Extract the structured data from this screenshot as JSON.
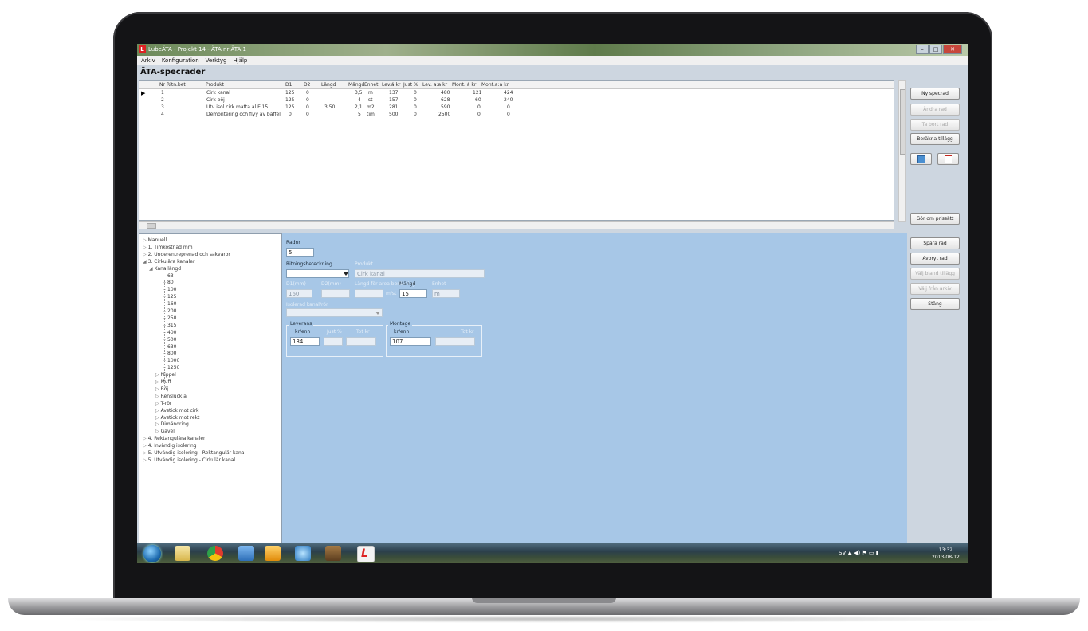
{
  "window": {
    "title": "LubeÄTA - Projekt 14 - ÄTA nr ÄTA 1",
    "menu": [
      "Arkiv",
      "Konfiguration",
      "Verktyg",
      "Hjälp"
    ]
  },
  "page_title": "ÄTA-specrader",
  "grid": {
    "columns": [
      "Nr",
      "Ritn.bet",
      "Produkt",
      "D1",
      "D2",
      "Längd",
      "Mängd",
      "Enhet",
      "Lev.á kr",
      "Just %",
      "Lev. a:a kr",
      "Mont. á kr",
      "Mont.a:a kr"
    ],
    "rows": [
      [
        "1",
        "",
        "Cirk kanal",
        "125",
        "0",
        "",
        "3,5",
        "m",
        "137",
        "0",
        "480",
        "121",
        "424"
      ],
      [
        "2",
        "",
        "Cirk böj",
        "125",
        "0",
        "",
        "4",
        "st",
        "157",
        "0",
        "628",
        "60",
        "240"
      ],
      [
        "3",
        "",
        "Utv isol cirk matta al El15",
        "125",
        "0",
        "3,50",
        "2,1",
        "m2",
        "281",
        "0",
        "590",
        "0",
        "0"
      ],
      [
        "4",
        "",
        "Demontering och flyy av baffel",
        "0",
        "0",
        "",
        "5",
        "tim",
        "500",
        "0",
        "2500",
        "0",
        "0"
      ]
    ]
  },
  "right_buttons": {
    "ny_specrad": "Ny specrad",
    "andra_rad": "Ändra rad",
    "ta_bort_rad": "Ta bort rad",
    "berakna_tillagg": "Beräkna tillägg",
    "gor_om_prissatt": "Gör om prissätt",
    "spara_rad": "Spara rad",
    "avbryt_rad": "Avbryt rad",
    "valj_bland_tillagg": "Välj bland tillägg",
    "valj_fran_arkiv": "Välj från arkiv",
    "stang": "Stäng"
  },
  "tree": {
    "items": [
      {
        "label": "Manuell",
        "level": 0
      },
      {
        "label": "1. Timkostnad mm",
        "level": 0
      },
      {
        "label": "2. Underentreprenad och sakvaror",
        "level": 0
      },
      {
        "label": "3. Cirkulära kanaler",
        "level": 0
      },
      {
        "label": "Kanallängd",
        "level": 1
      },
      {
        "label": "63",
        "level": 3
      },
      {
        "label": "80",
        "level": 3
      },
      {
        "label": "100",
        "level": 3
      },
      {
        "label": "125",
        "level": 3
      },
      {
        "label": "160",
        "level": 3
      },
      {
        "label": "200",
        "level": 3
      },
      {
        "label": "250",
        "level": 3
      },
      {
        "label": "315",
        "level": 3
      },
      {
        "label": "400",
        "level": 3
      },
      {
        "label": "500",
        "level": 3
      },
      {
        "label": "630",
        "level": 3
      },
      {
        "label": "800",
        "level": 3
      },
      {
        "label": "1000",
        "level": 3
      },
      {
        "label": "1250",
        "level": 3
      },
      {
        "label": "Nippel",
        "level": 2
      },
      {
        "label": "Muff",
        "level": 2
      },
      {
        "label": "Böj",
        "level": 2
      },
      {
        "label": "Rensluck a",
        "level": 2
      },
      {
        "label": "T-rör",
        "level": 2
      },
      {
        "label": "Avstick mot cirk",
        "level": 2
      },
      {
        "label": "Avstick mot rekt",
        "level": 2
      },
      {
        "label": "Dimändring",
        "level": 2
      },
      {
        "label": "Gavel",
        "level": 2
      },
      {
        "label": "4. Rektangulära kanaler",
        "level": 0
      },
      {
        "label": "4. Invändig isolering",
        "level": 0
      },
      {
        "label": "5. Utvändig isolering - Rektangulär kanal",
        "level": 0
      },
      {
        "label": "5. Utvändig isolering - Cirkulär kanal",
        "level": 0
      }
    ]
  },
  "editor": {
    "radnr_label": "Radnr",
    "radnr_value": "5",
    "ritning_label": "Ritningsbeteckning",
    "ritning_value": "",
    "produkt_label": "Produkt",
    "produkt_value": "Cirk kanal",
    "d1_label": "D1(mm)",
    "d1_value": "160",
    "d2_label": "D2(mm)",
    "d2_value": "",
    "langd_label": "Längd för area beräkning",
    "langd_value": "",
    "langd_unit": "m/st",
    "mangd_label": "Mängd",
    "mangd_value": "15",
    "enhet_label": "Enhet",
    "enhet_value": "m",
    "isol_label": "Isolerad kanal/rör",
    "leverans_label": "Leverans",
    "leverans_krenh_label": "kr/enh",
    "leverans_value": "134",
    "leverans_just_label": "Just %",
    "leverans_tot_label": "Tot kr",
    "montage_label": "Montage",
    "montage_krenh_label": "kr/enh",
    "montage_value": "107",
    "montage_tot_label": "Tot kr"
  },
  "taskbar": {
    "lang": "SV",
    "time": "13:32",
    "date": "2013-08-12"
  }
}
